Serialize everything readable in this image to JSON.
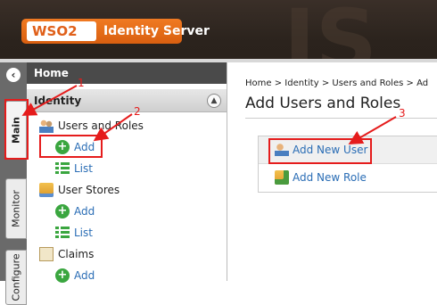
{
  "header": {
    "logo_text": "WSO2",
    "product_name": "Identity Server",
    "background_glyphs": [
      "IS"
    ]
  },
  "vertical_tabs": {
    "collapse_icon": "chevron-left-icon",
    "tabs": [
      {
        "label": "Main",
        "active": true
      },
      {
        "label": "Monitor",
        "active": false
      },
      {
        "label": "Configure",
        "active": false
      }
    ]
  },
  "sidebar": {
    "home_label": "Home",
    "section_label": "Identity",
    "section_toggle_icon": "chevron-up-icon",
    "groups": [
      {
        "label": "Users and Roles",
        "icon": "users-icon",
        "children": [
          {
            "label": "Add",
            "icon": "add-icon"
          },
          {
            "label": "List",
            "icon": "list-icon"
          }
        ]
      },
      {
        "label": "User Stores",
        "icon": "user-store-icon",
        "children": [
          {
            "label": "Add",
            "icon": "add-icon"
          },
          {
            "label": "List",
            "icon": "list-icon"
          }
        ]
      },
      {
        "label": "Claims",
        "icon": "claims-icon",
        "children": [
          {
            "label": "Add",
            "icon": "add-icon"
          }
        ]
      }
    ]
  },
  "main": {
    "breadcrumb": [
      "Home",
      "Identity",
      "Users and Roles",
      "Ad"
    ],
    "breadcrumb_separator": ">",
    "title": "Add Users and Roles",
    "actions": [
      {
        "label": "Add New User",
        "icon": "add-user-icon"
      },
      {
        "label": "Add New Role",
        "icon": "add-role-icon"
      }
    ]
  },
  "annotations": {
    "color": "#e51c1c",
    "markers": [
      "1",
      "2",
      "3"
    ]
  },
  "colors": {
    "header_bg": "#2b231d",
    "logo_orange": "#e0601a",
    "link_blue": "#2a6db5",
    "tab_strip_gray": "#6a6a6a"
  }
}
